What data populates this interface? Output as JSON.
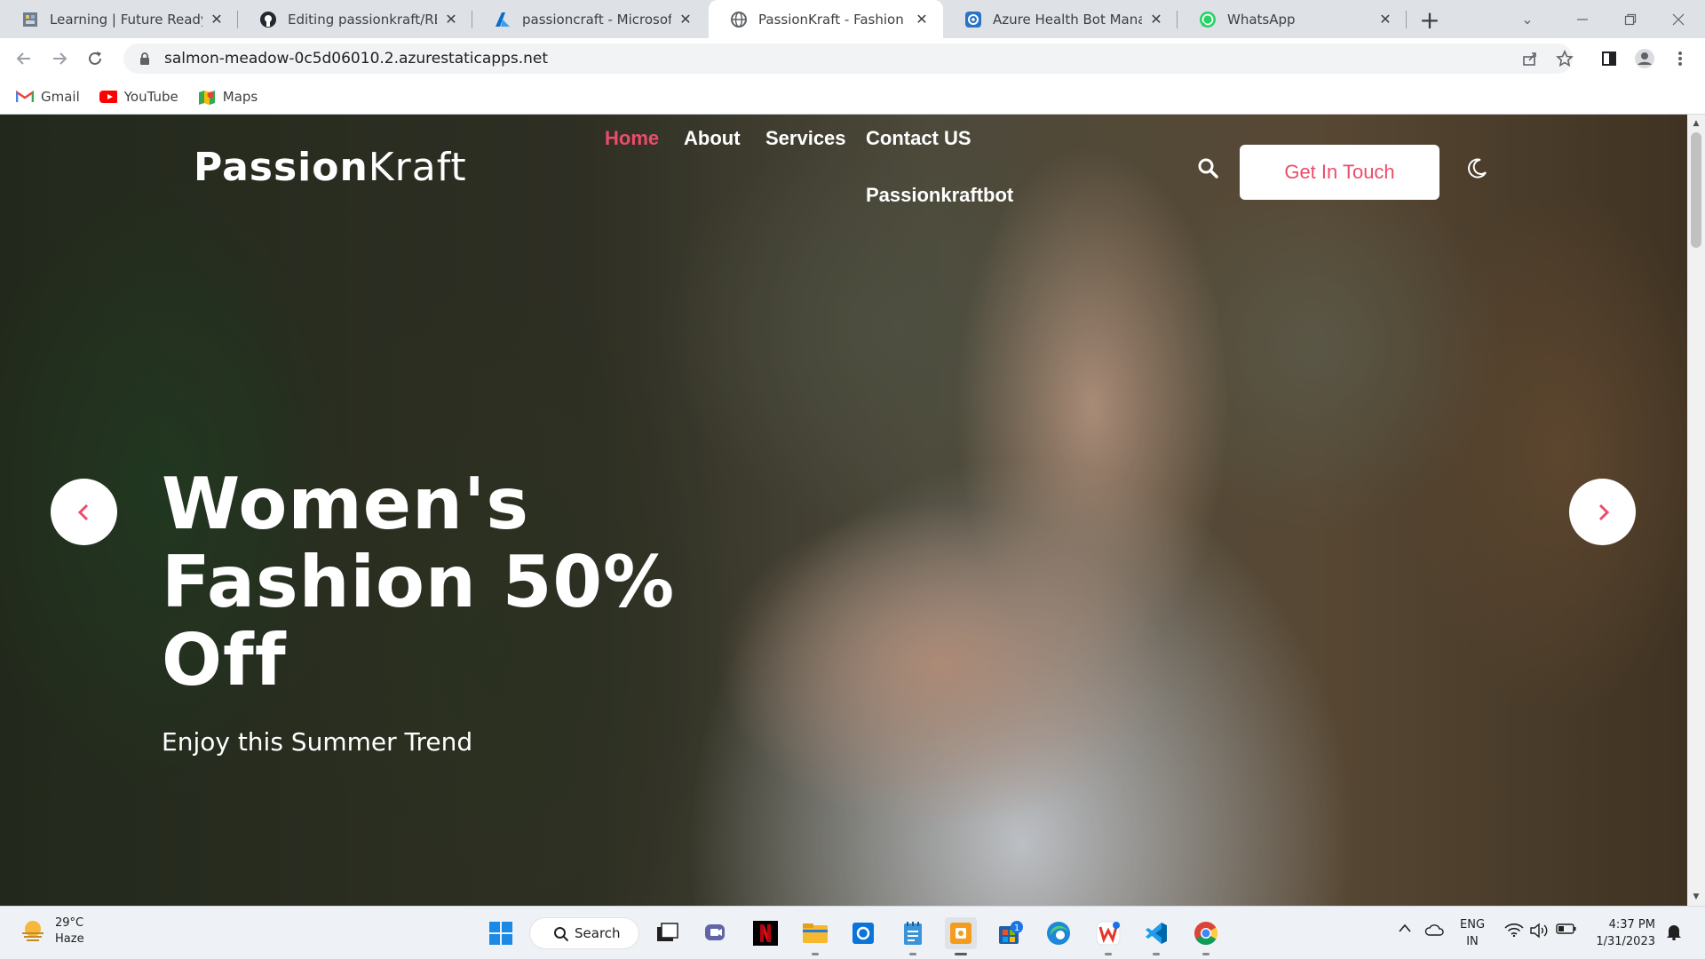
{
  "browser": {
    "tabs": [
      {
        "title": "Learning | Future Ready Tale",
        "icon": "learning-favicon",
        "active": false
      },
      {
        "title": "Editing passionkraft/READM",
        "icon": "github-icon",
        "active": false
      },
      {
        "title": "passioncraft - Microsoft Azu",
        "icon": "azure-icon",
        "active": false
      },
      {
        "title": "PassionKraft - Fashion Cate",
        "icon": "globe-icon",
        "active": true
      },
      {
        "title": "Azure Health Bot Managem",
        "icon": "health-bot-icon",
        "active": false
      },
      {
        "title": "WhatsApp",
        "icon": "whatsapp-icon",
        "active": false
      }
    ],
    "new_tab": "+",
    "url": "salmon-meadow-0c5d06010.2.azurestaticapps.net",
    "bookmarks": [
      {
        "label": "Gmail",
        "icon": "gmail-icon"
      },
      {
        "label": "YouTube",
        "icon": "youtube-icon"
      },
      {
        "label": "Maps",
        "icon": "maps-icon"
      }
    ]
  },
  "site": {
    "logo_bold": "Passion",
    "logo_light": "Kraft",
    "nav": [
      {
        "label": "Home",
        "active": true
      },
      {
        "label": "About",
        "active": false
      },
      {
        "label": "Services",
        "active": false
      },
      {
        "label": "Contact US",
        "active": false
      },
      {
        "label": "Passionkraftbot",
        "active": false
      }
    ],
    "cta_label": "Get In Touch",
    "hero": {
      "title_line1": "Women's",
      "title_line2": "Fashion 50%",
      "title_line3": "Off",
      "subtitle": "Enjoy this Summer Trend"
    },
    "accent_color": "#ec4c6b"
  },
  "taskbar": {
    "weather_temp": "29°C",
    "weather_cond": "Haze",
    "search_label": "Search",
    "apps": [
      {
        "name": "windows-start-icon"
      },
      {
        "name": "task-view-icon"
      },
      {
        "name": "teams-icon"
      },
      {
        "name": "netflix-icon"
      },
      {
        "name": "file-explorer-icon"
      },
      {
        "name": "outlook-icon"
      },
      {
        "name": "notepad-icon"
      },
      {
        "name": "app-orange-icon"
      },
      {
        "name": "store-icon",
        "badge": "1"
      },
      {
        "name": "edge-icon"
      },
      {
        "name": "wps-office-icon"
      },
      {
        "name": "vscode-icon"
      },
      {
        "name": "chrome-icon"
      }
    ],
    "lang_line1": "ENG",
    "lang_line2": "IN",
    "time": "4:37 PM",
    "date": "1/31/2023"
  }
}
